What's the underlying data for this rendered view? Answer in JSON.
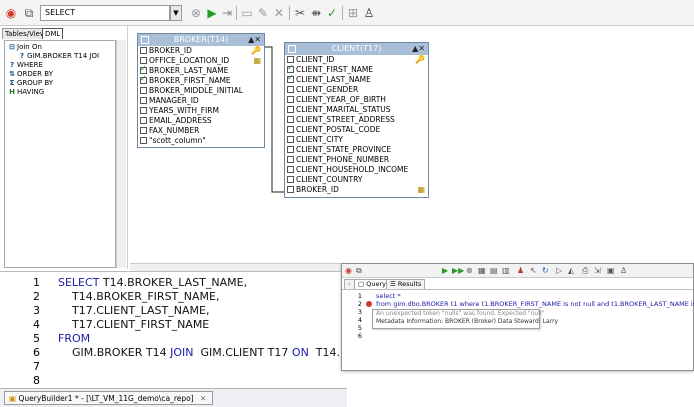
{
  "toolbar": {
    "statement_type": "SELECT",
    "icons": [
      "logo-icon",
      "copy-icon",
      "stop-icon",
      "run-icon",
      "new-icon",
      "edit-icon",
      "delete-icon",
      "cut-icon",
      "join-icon",
      "validate-icon",
      "filter-icon",
      "person-icon"
    ]
  },
  "left_panel": {
    "tabs": [
      "Tables/Views",
      "DML"
    ],
    "tree": [
      {
        "icon": "join-icon",
        "label": "Join On"
      },
      {
        "icon": "question-icon",
        "label": "GIM.BROKER T14 JOI"
      },
      {
        "icon": "question-icon",
        "label": "WHERE"
      },
      {
        "icon": "order-by-icon",
        "label": "ORDER BY"
      },
      {
        "icon": "sigma-icon",
        "label": "GROUP BY"
      },
      {
        "icon": "having-icon",
        "label": "HAVING"
      }
    ]
  },
  "broker_table": {
    "title": "BROKER(T14)",
    "columns": [
      {
        "name": "BROKER_ID",
        "checked": false
      },
      {
        "name": "OFFICE_LOCATION_ID",
        "checked": false
      },
      {
        "name": "BROKER_LAST_NAME",
        "checked": true
      },
      {
        "name": "BROKER_FIRST_NAME",
        "checked": true
      },
      {
        "name": "BROKER_MIDDLE_INITIAL",
        "checked": false
      },
      {
        "name": "MANAGER_ID",
        "checked": false
      },
      {
        "name": "YEARS_WITH_FIRM",
        "checked": false
      },
      {
        "name": "EMAIL_ADDRESS",
        "checked": false
      },
      {
        "name": "FAX_NUMBER",
        "checked": false
      },
      {
        "name": "\"scott_column\"",
        "checked": false
      }
    ]
  },
  "client_table": {
    "title": "CLIENT(T17)",
    "columns": [
      {
        "name": "CLIENT_ID",
        "checked": false
      },
      {
        "name": "CLIENT_FIRST_NAME",
        "checked": true
      },
      {
        "name": "CLIENT_LAST_NAME",
        "checked": true
      },
      {
        "name": "CLIENT_GENDER",
        "checked": false
      },
      {
        "name": "CLIENT_YEAR_OF_BIRTH",
        "checked": false
      },
      {
        "name": "CLIENT_MARITAL_STATUS",
        "checked": false
      },
      {
        "name": "CLIENT_STREET_ADDRESS",
        "checked": false
      },
      {
        "name": "CLIENT_POSTAL_CODE",
        "checked": false
      },
      {
        "name": "CLIENT_CITY",
        "checked": false
      },
      {
        "name": "CLIENT_STATE_PROVINCE",
        "checked": false
      },
      {
        "name": "CLIENT_PHONE_NUMBER",
        "checked": false
      },
      {
        "name": "CLIENT_HOUSEHOLD_INCOME",
        "checked": false
      },
      {
        "name": "CLIENT_COUNTRY",
        "checked": false
      },
      {
        "name": "BROKER_ID",
        "checked": false
      }
    ]
  },
  "editor": {
    "lines": [
      {
        "num": "1",
        "kw": "SELECT",
        "text": " T14.BROKER_LAST_NAME,"
      },
      {
        "num": "2",
        "kw": "",
        "text": "    T14.BROKER_FIRST_NAME,"
      },
      {
        "num": "3",
        "kw": "",
        "text": "    T17.CLIENT_LAST_NAME,"
      },
      {
        "num": "4",
        "kw": "",
        "text": "    T17.CLIENT_FIRST_NAME"
      },
      {
        "num": "5",
        "kw": "FROM",
        "text": ""
      },
      {
        "num": "6",
        "kw": "",
        "text": "    GIM.BROKER T14 ",
        "kw2": "JOIN",
        "text2": "  GIM.CLIENT T17 ",
        "kw3": "ON",
        "text3": "  T14.BF"
      },
      {
        "num": "7",
        "kw": "",
        "text": ""
      },
      {
        "num": "8",
        "kw": "",
        "text": ""
      }
    ]
  },
  "status_tab": "QueryBuilder1 * - [\\LT_VM_11G_demo\\ca_repo]",
  "query_window": {
    "tabs": [
      "Query",
      "Results"
    ],
    "lines": [
      {
        "num": "1",
        "text": "select *"
      },
      {
        "num": "2",
        "text": "from gim.dbo.BROKER t1 where t1.BROKER_FIRST_NAME is not null and t1.BROKER_LAST_NAME is null"
      },
      {
        "num": "3",
        "text": ""
      },
      {
        "num": "4",
        "text": ""
      },
      {
        "num": "5",
        "text": ""
      },
      {
        "num": "6",
        "text": ""
      }
    ],
    "error_line1": "An unexpected token \"nulls\" was found. Expected \"null\"",
    "error_line2": "Metadata Information: BROKER (Broker) Data Steward: Larry"
  },
  "colors": {
    "table_header": "#a9bfd8",
    "keyword": "#1a1aa8",
    "error_marker": "#d0382a",
    "run_green": "#2a9a2a"
  }
}
